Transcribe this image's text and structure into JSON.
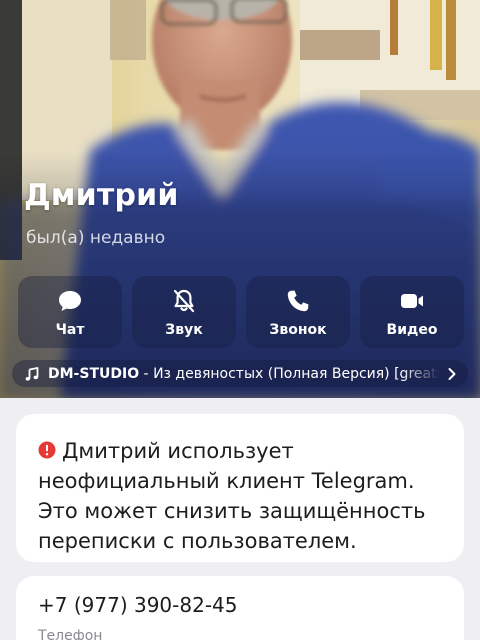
{
  "profile": {
    "name": "Дмитрий",
    "status": "был(а) недавно"
  },
  "actions": [
    {
      "label": "Чат",
      "icon": "chat-bubble-icon"
    },
    {
      "label": "Звук",
      "icon": "bell-muted-icon"
    },
    {
      "label": "Звонок",
      "icon": "phone-icon"
    },
    {
      "label": "Видео",
      "icon": "video-camera-icon"
    }
  ],
  "music": {
    "icon": "music-note-icon",
    "artist": "DM-STUDIO",
    "separator": " - ",
    "title": "Из девяностых (Полная Версия) [greatmuz."
  },
  "warning": {
    "icon": "exclamation-circle-icon",
    "text": "Дмитрий использует неофициальный клиент Telegram. Это может снизить защищённость переписки с пользователем.",
    "color": "#e53935"
  },
  "phone": {
    "number": "+7 (977) 390-82-45",
    "label": "Телефон"
  }
}
